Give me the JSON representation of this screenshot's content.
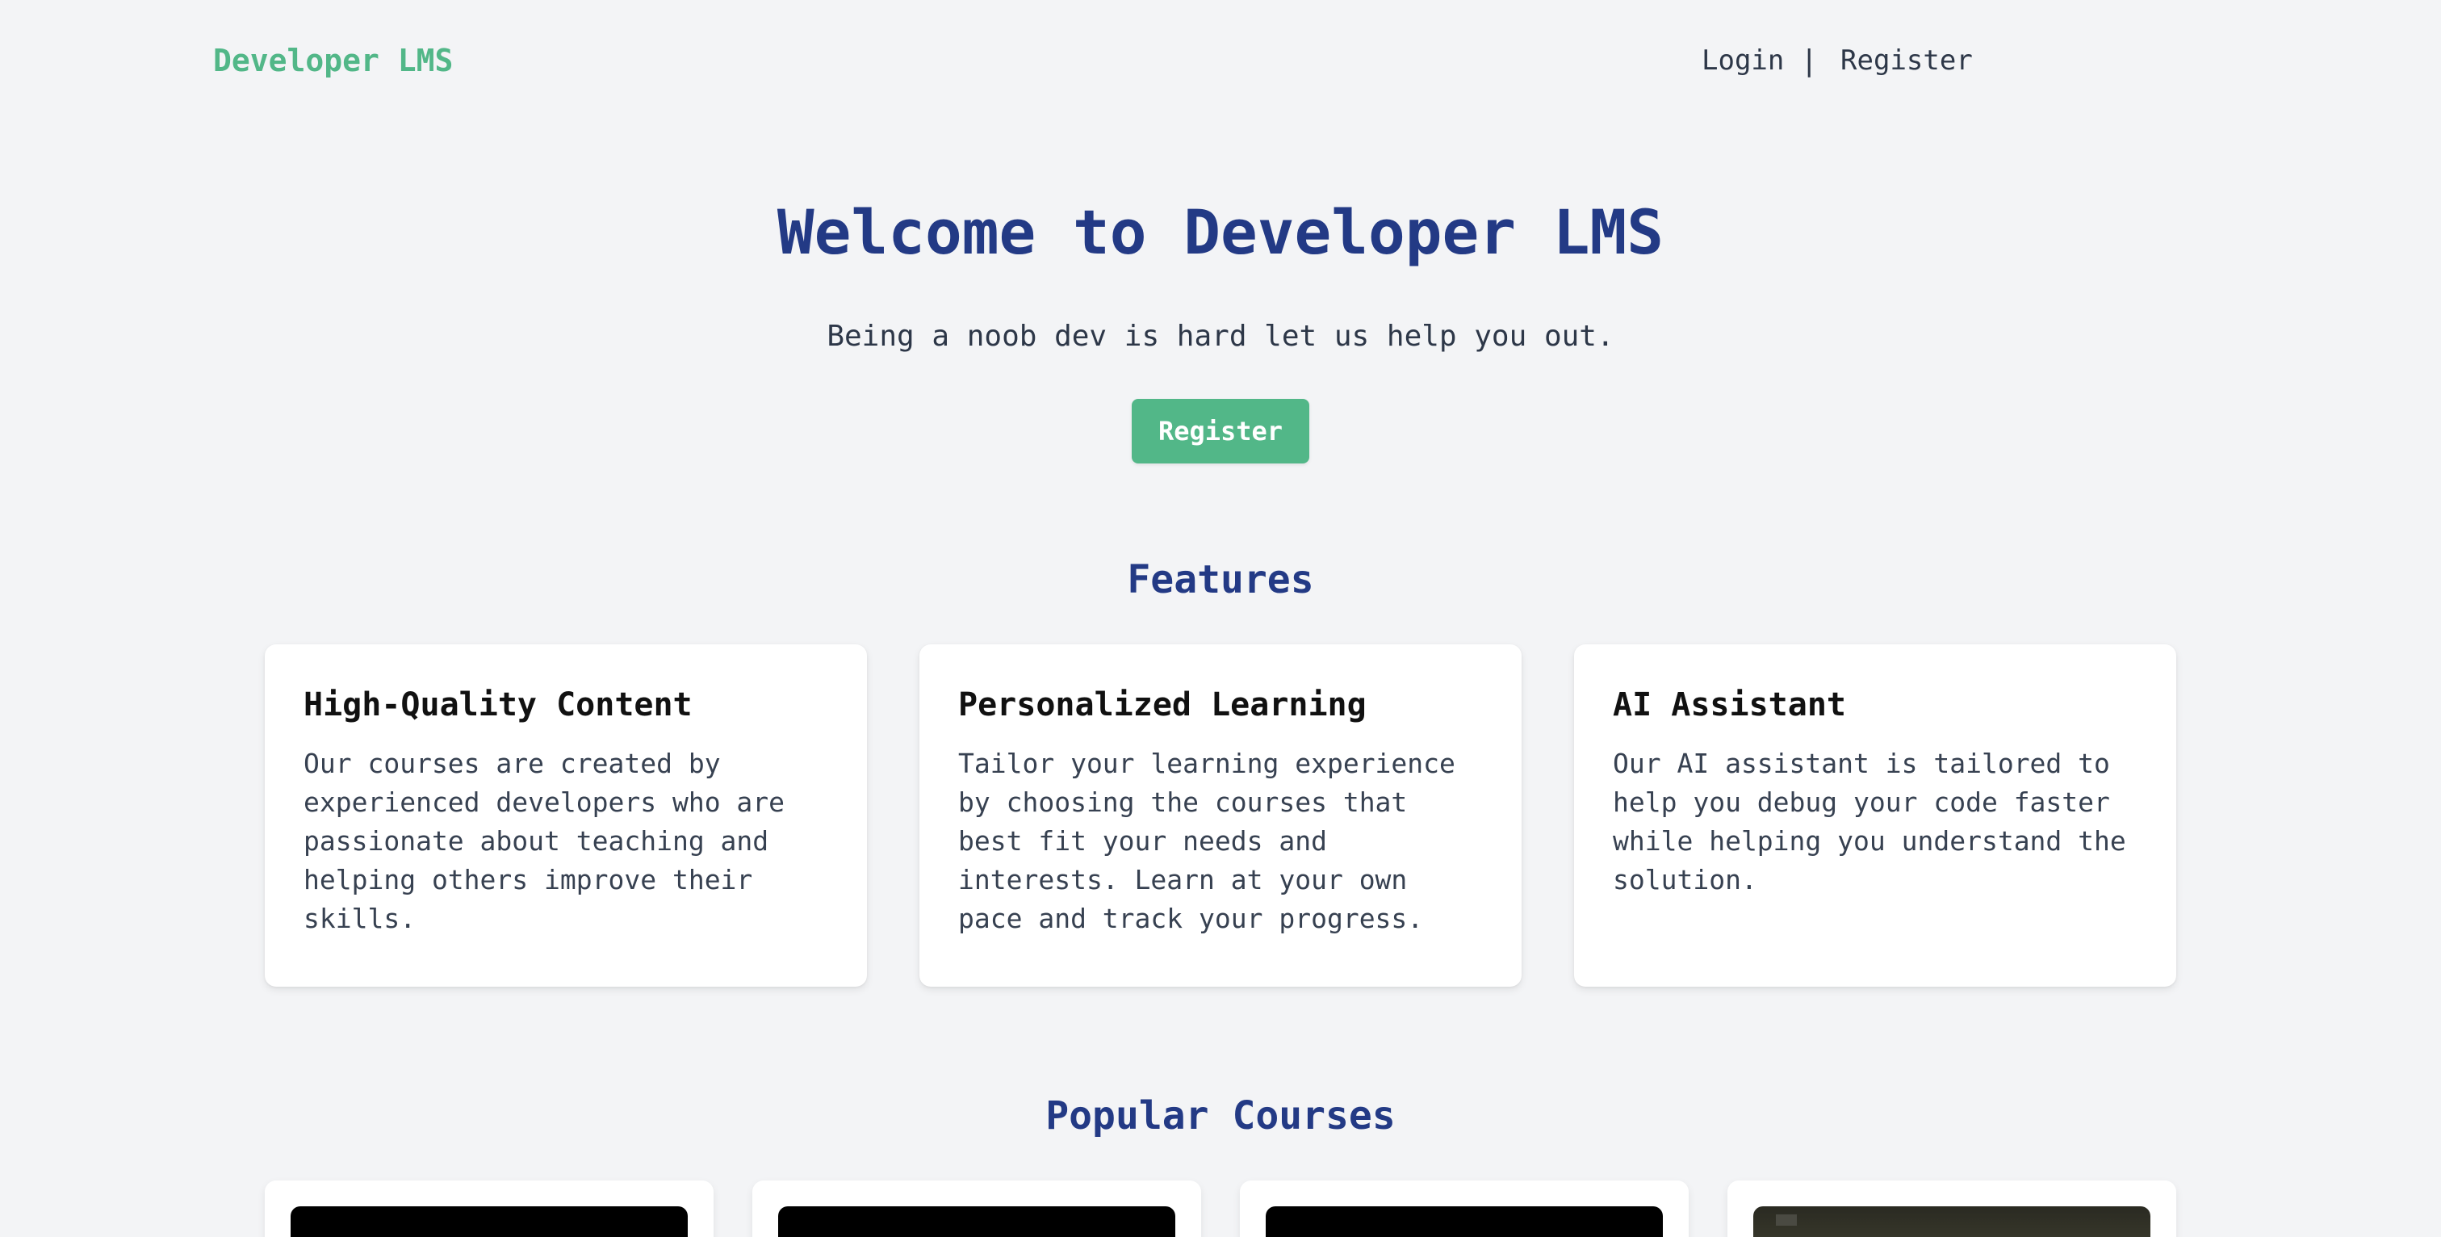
{
  "header": {
    "logo": "Developer LMS",
    "nav": {
      "login": "Login",
      "separator": "|",
      "register": "Register"
    }
  },
  "hero": {
    "title": "Welcome to Developer LMS",
    "subtitle": "Being a noob dev is hard let us help you out.",
    "cta_label": "Register"
  },
  "features": {
    "title": "Features",
    "items": [
      {
        "title": "High-Quality Content",
        "description": "Our courses are created by experienced developers who are passionate about teaching and helping others improve their skills."
      },
      {
        "title": "Personalized Learning",
        "description": "Tailor your learning experience by choosing the courses that best fit your needs and interests. Learn at your own pace and track your progress."
      },
      {
        "title": "AI Assistant",
        "description": "Our AI assistant is tailored to help you debug your code faster while helping you understand the solution."
      }
    ]
  },
  "courses": {
    "title": "Popular Courses"
  },
  "colors": {
    "brand_green": "#52b788",
    "heading_blue": "#233a85",
    "background": "#f3f4f6"
  }
}
